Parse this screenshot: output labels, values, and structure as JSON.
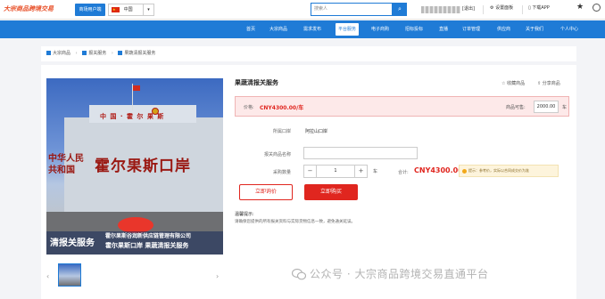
{
  "header": {
    "logo_text": "大宗商品跨境交易",
    "shop_button": "商场用户端",
    "country": "中国",
    "search_placeholder": "搜索人",
    "exit": "[退出]",
    "settings": "设置面板",
    "download": "下载APP"
  },
  "nav": {
    "items": [
      "首页",
      "大宗商品",
      "需求发布",
      "平台服务",
      "电子商购",
      "招标投标",
      "直播",
      "订单管理",
      "供应商",
      "关于我们",
      "个人中心"
    ],
    "active_index": 3
  },
  "breadcrumb": [
    "大宗商品",
    "报关服务",
    "果蔬清报关服务"
  ],
  "product": {
    "title": "果蔬清报关服务",
    "favorite": "收藏商品",
    "share": "分享商品",
    "price_label": "价格:",
    "price_value": "CNY4300.00/车",
    "available_label": "商品可售:",
    "available_value": "2000.00",
    "available_unit": "车",
    "port_label": "所属口岸",
    "port_value": "阿拉山口岸",
    "declare_name_label": "报关商品名称",
    "quantity_label": "采购数量",
    "quantity_value": "1",
    "quantity_unit": "车",
    "total_label": "合计:",
    "total_value": "CNY4300.00",
    "tip": "提示：参考价，实际以合同成交价为准",
    "inquiry_button": "立即询价",
    "buy_button": "立即购买",
    "note_heading": "温馨提示:",
    "note_body": "请确保您提供的所有报关资料与实际货物信息一致，避免通关延误。"
  },
  "image": {
    "overlay_title": "清报关服务",
    "overlay_company": "霍尔果斯谷润新供应链管理有限公司",
    "overlay_subtitle": "霍尔果斯口岸 果蔬清报关服务",
    "sign_building": "中 国 · 霍 尔 果 斯",
    "sign_left": "中华人民共和国",
    "sign_right": "霍尔果斯口岸"
  },
  "watermark": "公众号 · 大宗商品跨境交易直通平台",
  "colors": {
    "brand_blue": "#1f7bd6",
    "price_red": "#e0261f"
  }
}
